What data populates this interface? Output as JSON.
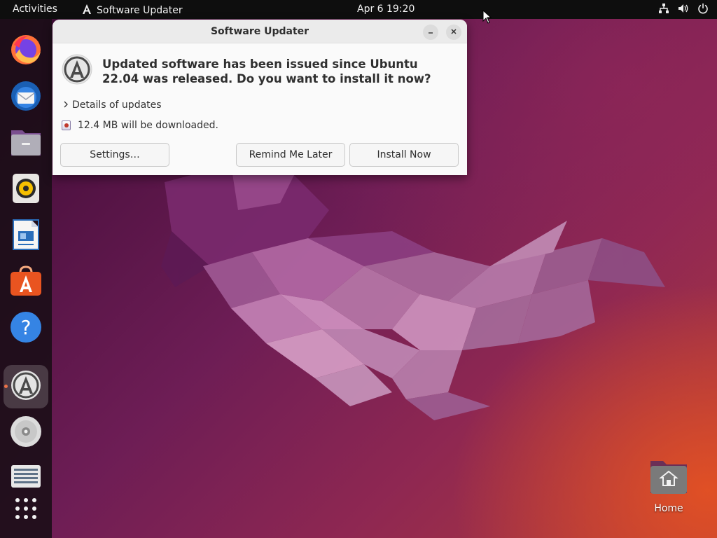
{
  "topbar": {
    "activities_label": "Activities",
    "app_name": "Software Updater",
    "clock": "Apr 6  19:20",
    "tray_icons": [
      "network-icon",
      "volume-icon",
      "power-icon"
    ]
  },
  "dock": {
    "items": [
      {
        "name": "Firefox",
        "icon": "firefox-icon"
      },
      {
        "name": "Thunderbird",
        "icon": "thunderbird-icon"
      },
      {
        "name": "Files",
        "icon": "files-icon"
      },
      {
        "name": "Rhythmbox",
        "icon": "rhythmbox-icon"
      },
      {
        "name": "LibreOffice Writer",
        "icon": "writer-icon"
      },
      {
        "name": "Ubuntu Software",
        "icon": "software-icon"
      },
      {
        "name": "Help",
        "icon": "help-icon"
      },
      {
        "name": "Software Updater",
        "icon": "updater-icon",
        "active": true
      },
      {
        "name": "Disc",
        "icon": "disc-icon"
      },
      {
        "name": "Trash",
        "icon": "trash-icon"
      },
      {
        "name": "Show Applications",
        "icon": "app-grid-icon"
      }
    ]
  },
  "dialog": {
    "title": "Software Updater",
    "headline": "Updated software has been issued since Ubuntu 22.04 was released. Do you want to install it now?",
    "details_label": "Details of updates",
    "download_info": "12.4 MB will be downloaded.",
    "buttons": {
      "settings": "Settings…",
      "remind": "Remind Me Later",
      "install": "Install Now"
    }
  },
  "desktop": {
    "home_label": "Home"
  },
  "colors": {
    "accent": "#e95420",
    "topbar": "#0e0e0e",
    "dialog_bg": "#fafafa"
  }
}
